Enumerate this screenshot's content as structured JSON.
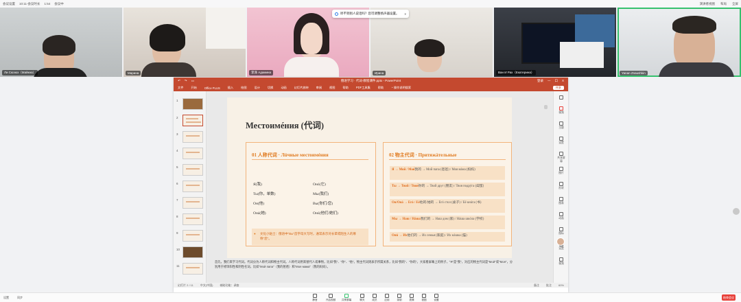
{
  "topbar": {
    "items": [
      "会议设置",
      "10:11-会议时长",
      "1:54",
      "会议中"
    ],
    "right": [
      "演讲者视图",
      "布局",
      "全屏"
    ]
  },
  "notice": {
    "text": "听不到别人说话吗？您可调整扬声器设置。"
  },
  "participants": [
    {
      "name": "Ли Сюэюэ（Майкна）"
    },
    {
      "name": "Марина"
    },
    {
      "name": "李泽 Адамина"
    },
    {
      "name": "Ирина"
    },
    {
      "name": "Ван И Рах（Екатерина）"
    },
    {
      "name": "Yanan Znaushkin"
    }
  ],
  "ppt": {
    "title": "俄语学习 · 代词-教程课件.pptx - PowerPoint",
    "title_right": [
      "登录",
      "一",
      "口",
      "X"
    ],
    "tabs": [
      "文件",
      "开始",
      "Office PLUS",
      "插入",
      "绘图",
      "设计",
      "切换",
      "动画",
      "幻灯片放映",
      "审阅",
      "视图",
      "帮助",
      "PDF工具集",
      "帮助"
    ],
    "tellme": "操作说明搜索",
    "share": "共享"
  },
  "slide": {
    "title": "Местоимéния (代词)",
    "left_title": "01 人称代词 · Лúчные местоимéния",
    "pronouns_left": [
      "Я(我)",
      "Ты(你，单数)",
      "Он(他)",
      "Онá(她)"
    ],
    "pronouns_right": [
      "Онó(它)",
      "Мы(我们)",
      "Вы(你们/您)",
      "Онú(他们/她们)"
    ],
    "tip": "文化小贴士：俄语中\"Вы\"首字母大写时，通常表示对长辈或陌生人的尊称\"您\"。",
    "right_title": "02 物主代词 · Притяжáтельные",
    "possessives": [
      {
        "head": "Я → Мой / Моя́",
        "rest": "我的 → Мой папа (爸爸) / Моя мáма (妈妈)"
      },
      {
        "head": "Ты → Твой / Твоя́",
        "rest": "你的 → Твой друг (朋友) / Твоя подрýга (闺蜜)"
      },
      {
        "head": "Он/Онá → Егó / Её",
        "rest": "他的/她的 → Егó стол (桌子) / Её кнúга (书)"
      },
      {
        "head": "Мы → Наш / Нáша",
        "rest": "我们的 → Наш дом (家) / Нáша шкóла (学校)"
      },
      {
        "head": "Онú → Их",
        "rest": "他们的 → Их семья (家庭) / Их кóшка (猫)"
      }
    ]
  },
  "notes": "首先，我们来学习代词。代词分为人称代词和物主代词。人称代词用来替代人或事物，比如\"我\"、\"你\"、\"他\"。物主代词则表示所属关系，比如\"我的\"、\"你的\"。大家看屏幕上的例子，\"Я\"是\"我\"，对应的物主代词是\"Мой\"或\"Моя\"，分别用于修饰阳性和阴性名词，比如\"Мой папа\"（我的爸爸）和\"Моя мама\"（我的妈妈）。",
  "status": [
    "幻灯片 2 / 11",
    "中文(中国)",
    "辅助功能：调查",
    "备注",
    "批注",
    "60%"
  ],
  "right_panel": [
    "视频",
    "主题",
    "设置",
    "共享屏幕",
    "图片",
    "形状",
    "图表",
    "动画",
    "图标",
    "设置",
    "视频"
  ],
  "thumb_numbers": [
    "1",
    "2",
    "3",
    "4",
    "5",
    "6",
    "7",
    "8",
    "9",
    "10",
    "11"
  ],
  "toolbar": [
    "静音",
    "开启视频",
    "共享屏幕",
    "聊天",
    "成员",
    "应用",
    "录制",
    "表情",
    "视图",
    "设置"
  ],
  "leave": "结束会议",
  "bottom_chips": [
    "设置",
    "同步"
  ]
}
